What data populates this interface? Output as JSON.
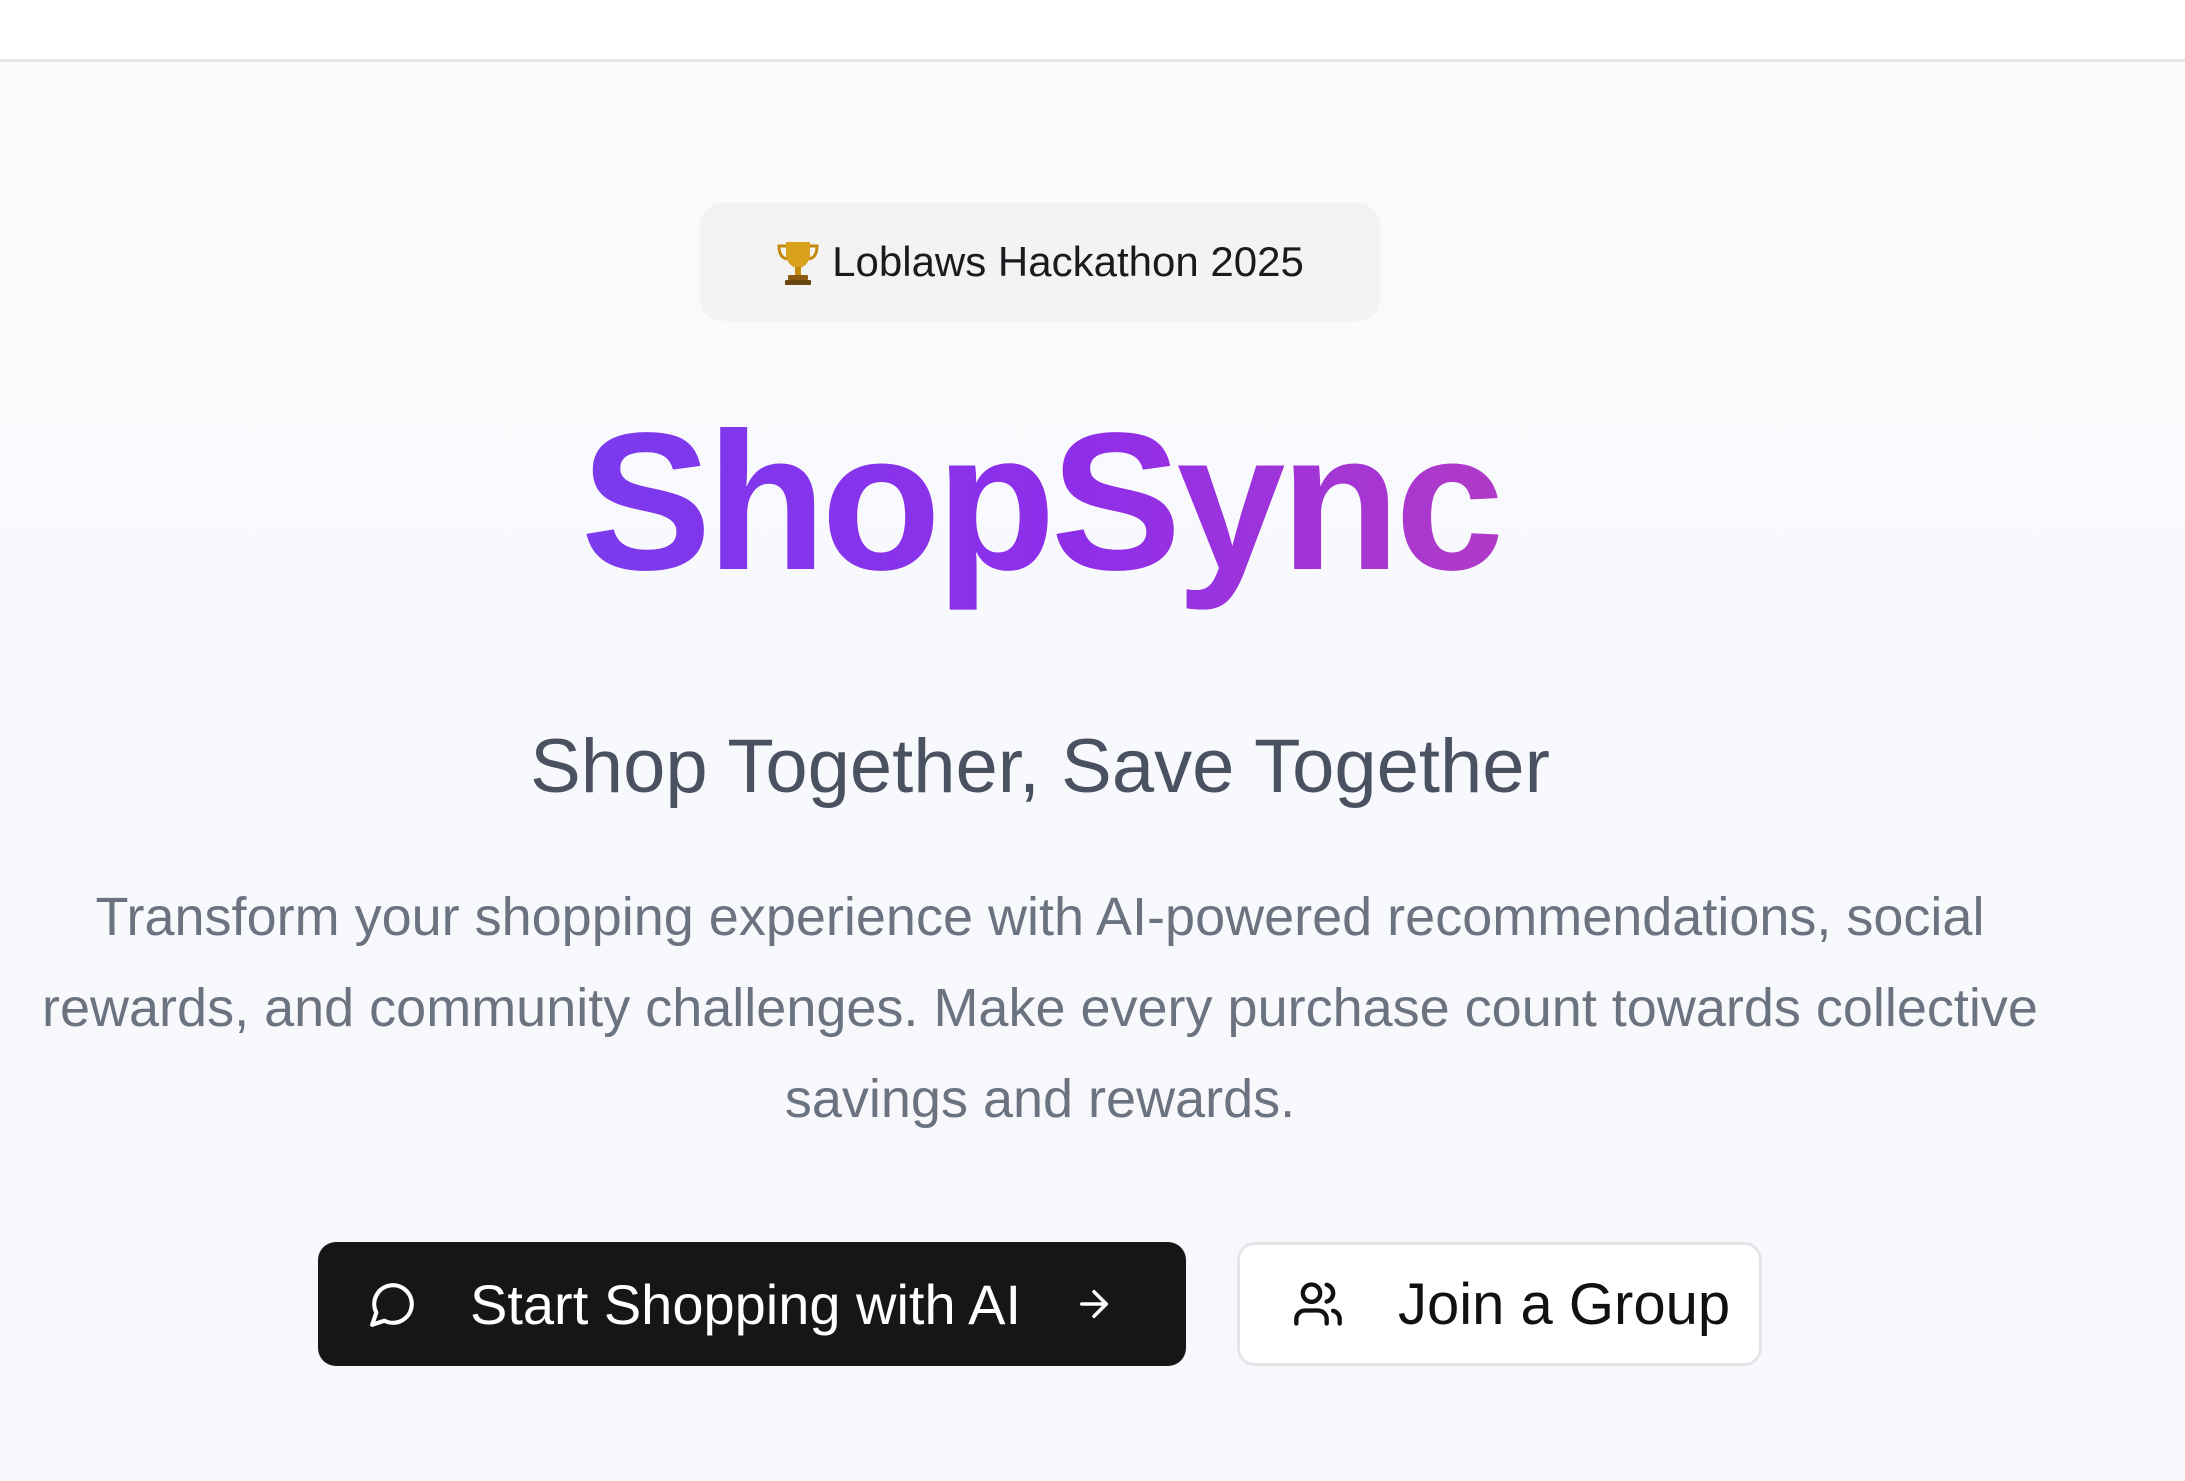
{
  "badge": {
    "icon": "trophy-icon",
    "label": "Loblaws Hackathon 2025"
  },
  "hero": {
    "title": "ShopSync",
    "title_gradient": [
      "#7b3aed",
      "#8f2ee9",
      "#b13ac7"
    ],
    "subtitle": "Shop Together, Save Together",
    "description_lines": [
      "Transform your shopping experience with AI-powered recommendations, social",
      "rewards, and community challenges. Make every purchase count towards collective",
      "savings and rewards."
    ]
  },
  "actions": {
    "primary": {
      "icon": "chat-bubble-icon",
      "label": "Start Shopping with AI",
      "trailing_icon": "arrow-right-icon",
      "color": "#161616"
    },
    "secondary": {
      "icon": "users-icon",
      "label": "Join a Group",
      "color": "#ffffff"
    }
  }
}
